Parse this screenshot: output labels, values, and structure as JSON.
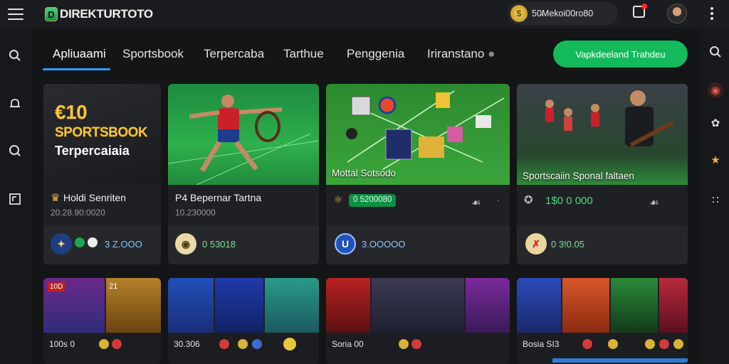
{
  "app": {
    "logo_text": "DIREKTURTOTO",
    "logo_letter": "D"
  },
  "header": {
    "wallet_text": "50̴Mekoi00ro80",
    "coin_symbol": "$"
  },
  "nav": {
    "tabs": [
      {
        "label": "Apliuaami"
      },
      {
        "label": "Sportsbook"
      },
      {
        "label": "Terpercaba"
      },
      {
        "label": "Tarthue"
      },
      {
        "label": "Penggenia"
      },
      {
        "label": "Iriranstano"
      }
    ],
    "cta_label": "Vapkdeeland Trahdeu"
  },
  "cards": [
    {
      "hero_line1": "€10",
      "hero_line2": "SPORTSBOOK",
      "hero_line3": "Terpercaiaia",
      "caption": "Holdi Senriten",
      "sub": "20.28.90:0020",
      "footer_value": "3 Z.OOO"
    },
    {
      "caption": "P4  Bepernar Tartna",
      "sub": "10.230000",
      "footer_value": "0 53018"
    },
    {
      "art_label": "Mottal Sotsodo",
      "badge": "0 5200080",
      "footer_value": "3.OOOOO"
    },
    {
      "art_label": "Sportscaiin Sponal faltaen",
      "green_value": "1$0 0 000",
      "footer_value": "0 3!0.05"
    }
  ],
  "bottom_cards": [
    {
      "strip": "100s 0",
      "tags": [
        "10D",
        "21"
      ]
    },
    {
      "strip": "30.306",
      "tags": []
    },
    {
      "strip": "Soria    00",
      "tags": []
    },
    {
      "strip": "Bosia   SI3",
      "tags": []
    }
  ],
  "colors": {
    "accent_green": "#14b95c",
    "active_tab_underline": "#2e9cff",
    "gold": "#f5c63a"
  }
}
